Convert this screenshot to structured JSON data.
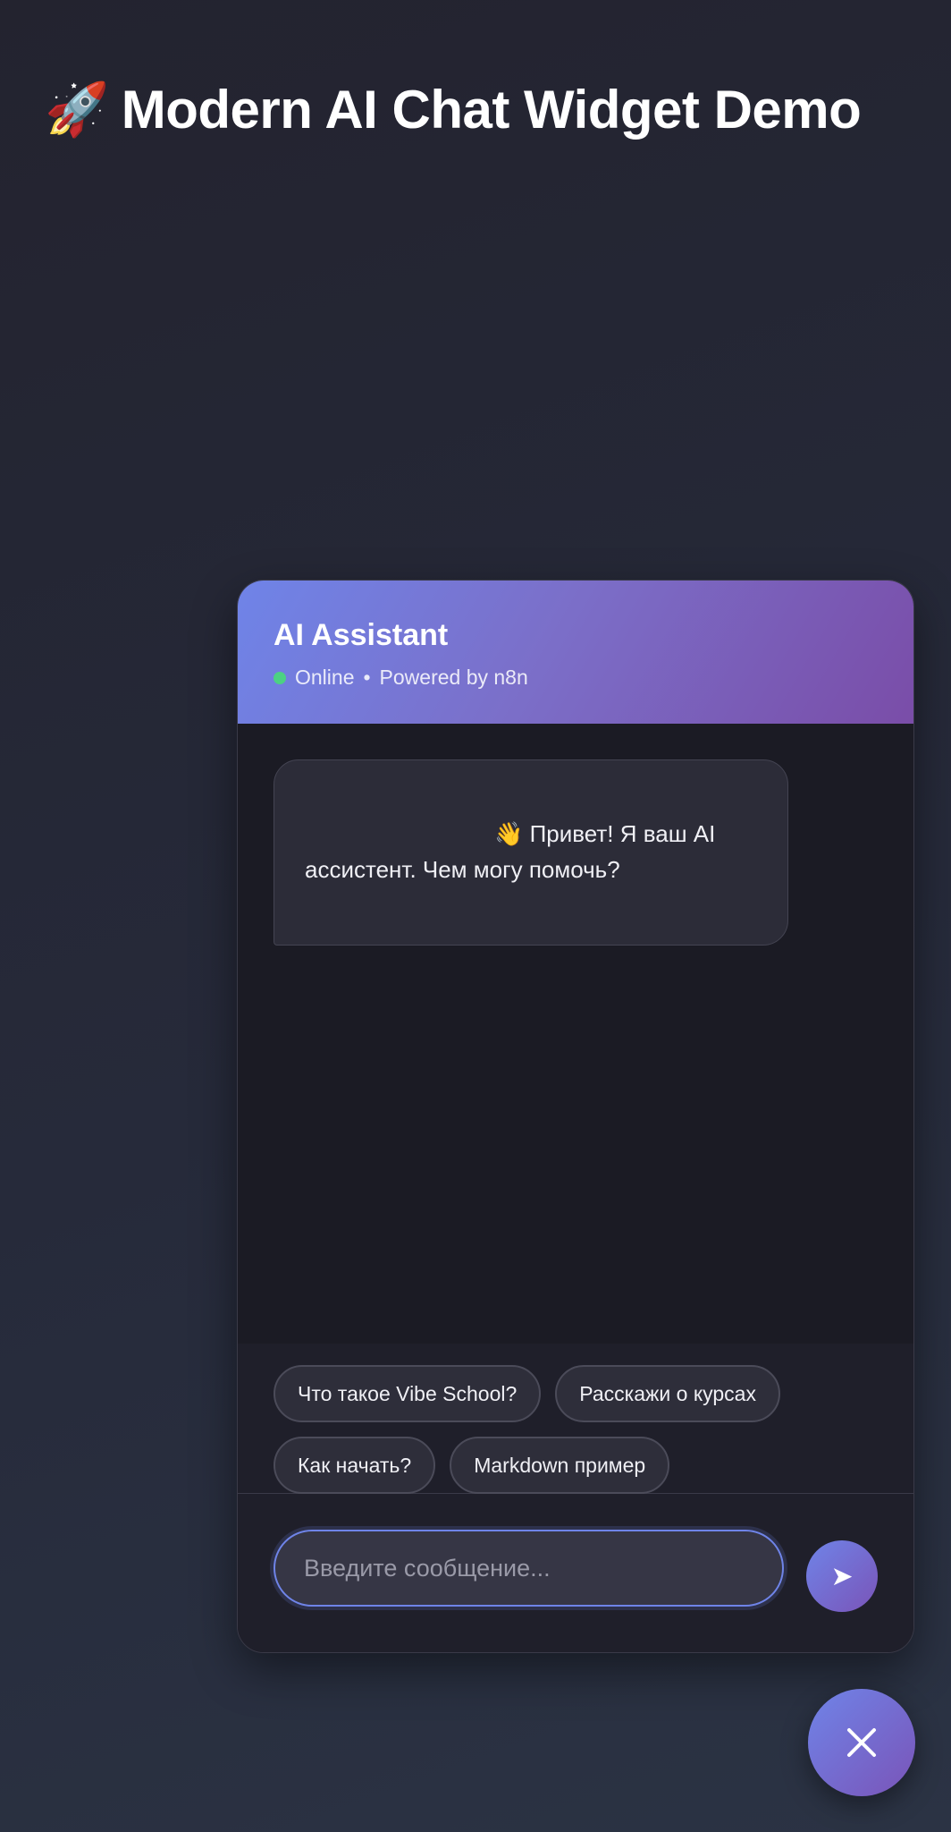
{
  "page": {
    "title_icon": "🚀",
    "title": "Modern AI Chat Widget Demo"
  },
  "widget": {
    "header": {
      "title": "AI Assistant",
      "status": "Online",
      "separator": "•",
      "powered_by": "Powered by n8n",
      "status_color": "#4cd183"
    },
    "messages": [
      {
        "role": "assistant",
        "text": "👋 Привет! Я ваш AI ассистент. Чем могу помочь?"
      }
    ],
    "suggestions": [
      "Что такое Vibe School?",
      "Расскажи о курсах",
      "Как начать?",
      "Markdown пример"
    ],
    "input": {
      "value": "",
      "placeholder": "Введите сообщение..."
    },
    "send_icon": "send-icon",
    "close_icon": "close-icon"
  },
  "colors": {
    "accent_start": "#6f84e8",
    "accent_end": "#7a4da8"
  }
}
